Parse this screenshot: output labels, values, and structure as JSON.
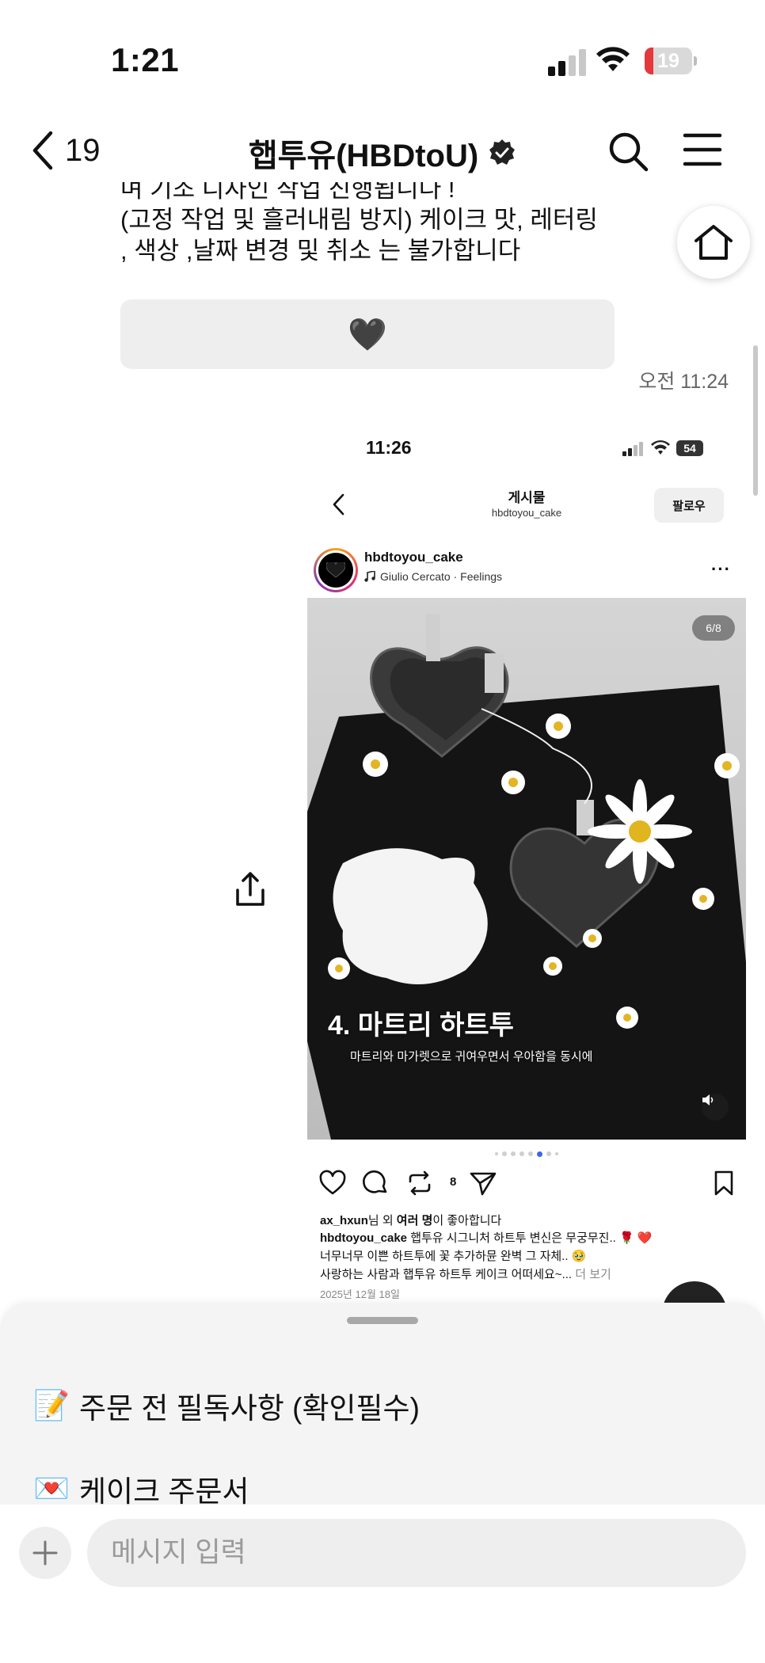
{
  "status_bar": {
    "time": "1:21",
    "battery_level": "19",
    "battery_color": "#e5383b"
  },
  "header": {
    "back_count": "19",
    "title": "햅투유(HBDtoU)",
    "verified": true
  },
  "message": {
    "partial_line": "며 기조 디자인 작업 진행됩니다 !",
    "lines": [
      "(고정 작업 및 흘러내림 방지) 케이크 맛, 레터링",
      ", 색상 ,날짜 변경 및 취소 는 불가합니다"
    ],
    "quick_reply_emoji": "🖤",
    "timestamp": "오전 11:24"
  },
  "shared_post": {
    "status_time": "11:26",
    "battery": "54",
    "page_title": "게시물",
    "page_subtitle": "hbdtoyou_cake",
    "follow_label": "팔로우",
    "username": "hbdtoyou_cake",
    "music": "Giulio Cercato · Feelings",
    "counter": "6/8",
    "overlay_title": "4. 마트리 하트투",
    "overlay_subtitle": "마트리와 마가렛으로 귀여우면서 우아함을 동시에",
    "carousel_active_index": 5,
    "repost_count": "8",
    "likes_user": "ax_hxun",
    "likes_mid": "님 외 ",
    "likes_many": "여러 명",
    "likes_suffix": "이 좋아합니다",
    "caption_user": "hbdtoyou_cake",
    "caption_line1": " 햅투유 시그니처 하트투 변신은 무궁무진.. 🌹 ❤️",
    "caption_line2": "너무너무 이쁜 하트투에 꽃 추가하뮨 완벽 그 자체.. 🥹",
    "caption_line3": "사랑하는 사람과 햅투유 하트투 케이크 어떠세요~... ",
    "caption_more": "더 보기",
    "date": "2025년 12월 18일"
  },
  "sheet": {
    "items": [
      {
        "emoji": "📝",
        "label": "주문 전 필독사항 (확인필수)"
      },
      {
        "emoji": "💌",
        "label": "케이크 주문서"
      }
    ]
  },
  "composer": {
    "placeholder": "메시지 입력",
    "value": ""
  },
  "icons": [
    "back-chevron-icon",
    "verified-badge-icon",
    "search-icon",
    "menu-icon",
    "home-icon",
    "share-icon",
    "plus-icon"
  ]
}
